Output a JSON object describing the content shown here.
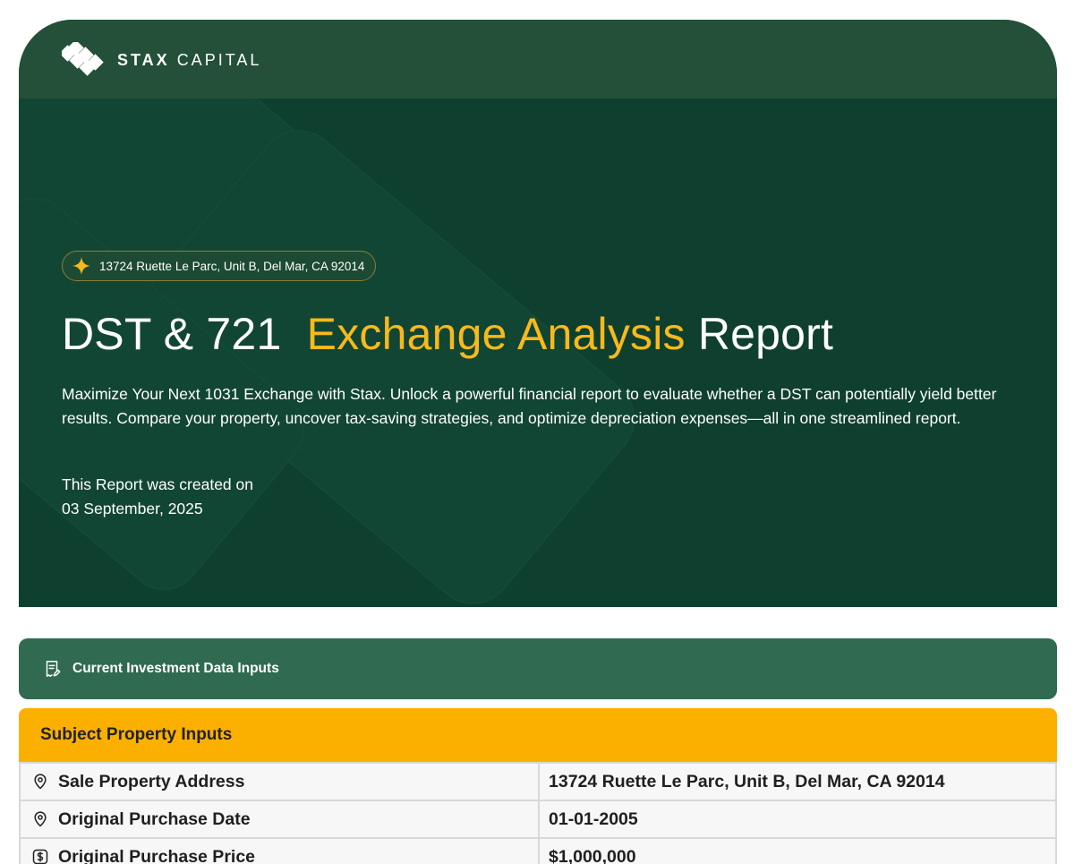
{
  "brand": {
    "name_bold": "STAX",
    "name_light": "CAPITAL",
    "logo_icon": "stax-diamond-logo"
  },
  "colors": {
    "hero_bg": "#0f402f",
    "hero_topbar": "#245039",
    "accent_gold": "#f8b91b",
    "section_green": "#306a50",
    "table_header_yellow": "#fbb000"
  },
  "hero": {
    "address_badge": "13724 Ruette Le Parc, Unit B, Del Mar, CA 92014",
    "badge_icon": "sparkle-icon",
    "title_part1": "DST & 721",
    "title_accent": "Exchange Analysis",
    "title_part2": "Report",
    "description": "Maximize Your Next 1031 Exchange with Stax. Unlock a powerful financial report to evaluate whether a DST can potentially yield better results. Compare your property, uncover tax-saving strategies, and optimize depreciation expenses—all in one streamlined report.",
    "created_label": "This Report was created on",
    "created_date": "03 September, 2025"
  },
  "section": {
    "title": "Current Investment Data Inputs",
    "icon": "receipt-edit-icon"
  },
  "subject_property": {
    "header": "Subject Property Inputs",
    "rows": [
      {
        "label": "Sale Property Address",
        "value": "13724 Ruette Le Parc, Unit B, Del Mar, CA 92014",
        "icon": "location-pin-icon"
      },
      {
        "label": "Original Purchase Date",
        "value": "01-01-2005",
        "icon": "location-pin-icon"
      },
      {
        "label": "Original Purchase Price",
        "value": "$1,000,000",
        "icon": "dollar-icon"
      }
    ]
  }
}
